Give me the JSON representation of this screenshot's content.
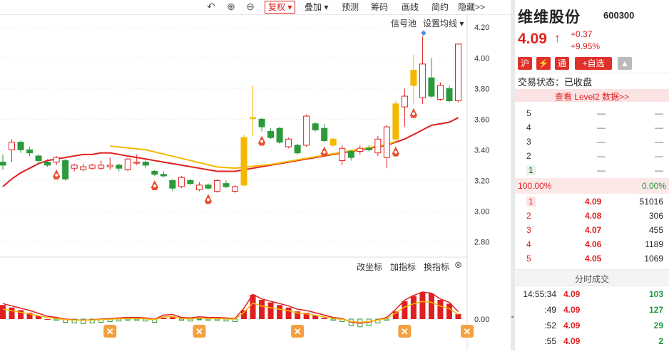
{
  "toolbar": {
    "undo_icon": "undo-icon",
    "zoom_in_icon": "zoom-in-icon",
    "zoom_out_icon": "zoom-out-icon",
    "fuquan": "复权",
    "diejia": "叠加",
    "yuce": "预测",
    "choumа": "筹码",
    "chouma": "筹码",
    "huaxian": "画线",
    "jianyue": "简约",
    "yincang": "隐藏>>"
  },
  "chart": {
    "signal_pool": "信号池",
    "set_ma": "设置均线",
    "price_ticks": [
      "4.20",
      "4.00",
      "3.80",
      "3.60",
      "3.40",
      "3.20",
      "3.00",
      "2.80"
    ],
    "indicator_ticks": [
      "0.00"
    ],
    "change_axis": "改坐标",
    "add_indicator": "加指标",
    "swap_indicator": "换指标",
    "colors": {
      "up": "#e02020",
      "down": "#2a9a3a",
      "highlight": "#f5b800",
      "ma": "#e02020",
      "ma2": "#f5b800"
    }
  },
  "chart_data": {
    "type": "candlestick",
    "ylim": [
      2.7,
      4.28
    ],
    "candles": [
      {
        "o": 3.32,
        "c": 3.3,
        "h": 3.37,
        "l": 3.27
      },
      {
        "o": 3.4,
        "c": 3.45,
        "h": 3.47,
        "l": 3.32
      },
      {
        "o": 3.45,
        "c": 3.4,
        "h": 3.46,
        "l": 3.38
      },
      {
        "o": 3.4,
        "c": 3.38,
        "h": 3.42,
        "l": 3.36
      },
      {
        "o": 3.36,
        "c": 3.33,
        "h": 3.37,
        "l": 3.31
      },
      {
        "o": 3.32,
        "c": 3.3,
        "h": 3.34,
        "l": 3.29
      },
      {
        "o": 3.32,
        "c": 3.35,
        "h": 3.36,
        "l": 3.3
      },
      {
        "o": 3.33,
        "c": 3.21,
        "h": 3.34,
        "l": 3.2
      },
      {
        "o": 3.28,
        "c": 3.3,
        "h": 3.31,
        "l": 3.26
      },
      {
        "o": 3.27,
        "c": 3.29,
        "h": 3.31,
        "l": 3.26
      },
      {
        "o": 3.28,
        "c": 3.3,
        "h": 3.31,
        "l": 3.27
      },
      {
        "o": 3.28,
        "c": 3.3,
        "h": 3.33,
        "l": 3.27
      },
      {
        "o": 3.29,
        "c": 3.3,
        "h": 3.35,
        "l": 3.27
      },
      {
        "o": 3.3,
        "c": 3.28,
        "h": 3.31,
        "l": 3.26
      },
      {
        "o": 3.27,
        "c": 3.34,
        "h": 3.35,
        "l": 3.26
      },
      {
        "o": 3.32,
        "c": 3.32,
        "h": 3.37,
        "l": 3.3
      },
      {
        "o": 3.32,
        "c": 3.3,
        "h": 3.33,
        "l": 3.28
      },
      {
        "o": 3.26,
        "c": 3.24,
        "h": 3.27,
        "l": 3.23
      },
      {
        "o": 3.24,
        "c": 3.23,
        "h": 3.26,
        "l": 3.22
      },
      {
        "o": 3.2,
        "c": 3.15,
        "h": 3.21,
        "l": 3.13
      },
      {
        "o": 3.16,
        "c": 3.22,
        "h": 3.23,
        "l": 3.15
      },
      {
        "o": 3.2,
        "c": 3.18,
        "h": 3.21,
        "l": 3.17
      },
      {
        "o": 3.14,
        "c": 3.17,
        "h": 3.19,
        "l": 3.13
      },
      {
        "o": 3.17,
        "c": 3.15,
        "h": 3.18,
        "l": 3.14
      },
      {
        "o": 3.13,
        "c": 3.2,
        "h": 3.21,
        "l": 3.12
      },
      {
        "o": 3.18,
        "c": 3.16,
        "h": 3.2,
        "l": 3.15
      },
      {
        "o": 3.13,
        "c": 3.16,
        "h": 3.17,
        "l": 3.12
      },
      {
        "o": 3.17,
        "c": 3.48,
        "h": 3.5,
        "l": 3.16,
        "hl": true
      },
      {
        "o": 3.61,
        "c": 3.61,
        "h": 3.82,
        "l": 3.49,
        "hl": true
      },
      {
        "o": 3.6,
        "c": 3.55,
        "h": 3.61,
        "l": 3.52
      },
      {
        "o": 3.52,
        "c": 3.48,
        "h": 3.54,
        "l": 3.47
      },
      {
        "o": 3.54,
        "c": 3.45,
        "h": 3.55,
        "l": 3.44
      },
      {
        "o": 3.42,
        "c": 3.47,
        "h": 3.48,
        "l": 3.41
      },
      {
        "o": 3.43,
        "c": 3.38,
        "h": 3.44,
        "l": 3.37
      },
      {
        "o": 3.43,
        "c": 3.62,
        "h": 3.63,
        "l": 3.42
      },
      {
        "o": 3.57,
        "c": 3.53,
        "h": 3.58,
        "l": 3.52
      },
      {
        "o": 3.54,
        "c": 3.46,
        "h": 3.57,
        "l": 3.45
      },
      {
        "o": 3.47,
        "c": 3.43,
        "h": 3.48,
        "l": 3.42,
        "hl": true
      },
      {
        "o": 3.33,
        "c": 3.41,
        "h": 3.43,
        "l": 3.3
      },
      {
        "o": 3.39,
        "c": 3.35,
        "h": 3.4,
        "l": 3.33
      },
      {
        "o": 3.39,
        "c": 3.41,
        "h": 3.43,
        "l": 3.37
      },
      {
        "o": 3.41,
        "c": 3.4,
        "h": 3.43,
        "l": 3.39
      },
      {
        "o": 3.38,
        "c": 3.47,
        "h": 3.49,
        "l": 3.36
      },
      {
        "o": 3.35,
        "c": 3.55,
        "h": 3.56,
        "l": 3.28
      },
      {
        "o": 3.47,
        "c": 3.7,
        "h": 3.72,
        "l": 3.45,
        "hl": true
      },
      {
        "o": 3.68,
        "c": 3.75,
        "h": 3.8,
        "l": 3.55
      },
      {
        "o": 3.82,
        "c": 3.92,
        "h": 4.02,
        "l": 3.7,
        "hl": true
      },
      {
        "o": 3.74,
        "c": 3.96,
        "h": 4.14,
        "l": 3.7
      },
      {
        "o": 3.87,
        "c": 3.75,
        "h": 4.0,
        "l": 3.74
      },
      {
        "o": 3.73,
        "c": 3.82,
        "h": 3.84,
        "l": 3.72
      },
      {
        "o": 3.8,
        "c": 3.72,
        "h": 3.82,
        "l": 3.71
      },
      {
        "o": 3.72,
        "c": 4.09,
        "h": 4.09,
        "l": 3.71
      }
    ],
    "ma_levels": [
      3.16,
      3.21,
      3.25,
      3.28,
      3.31,
      3.33,
      3.34,
      3.35,
      3.36,
      3.37,
      3.37,
      3.38,
      3.38,
      3.37,
      3.36,
      3.35,
      3.34,
      3.33,
      3.32,
      3.31,
      3.3,
      3.29,
      3.28,
      3.27,
      3.26,
      3.26,
      3.26,
      3.27,
      3.28,
      3.29,
      3.3,
      3.31,
      3.32,
      3.33,
      3.34,
      3.35,
      3.36,
      3.37,
      3.38,
      3.39,
      3.4,
      3.41,
      3.42,
      3.43,
      3.45,
      3.47,
      3.5,
      3.53,
      3.56,
      3.57,
      3.58,
      3.61
    ],
    "indicator": {
      "bars": [
        0.22,
        0.18,
        0.14,
        0.1,
        0.05,
        0.0,
        -0.02,
        -0.05,
        -0.06,
        -0.07,
        -0.06,
        -0.05,
        -0.04,
        -0.03,
        -0.02,
        -0.02,
        -0.03,
        -0.05,
        0.02,
        0.03,
        -0.02,
        -0.03,
        -0.01,
        -0.02,
        -0.02,
        -0.03,
        -0.04,
        0.14,
        0.38,
        0.3,
        0.26,
        0.22,
        0.18,
        0.12,
        0.1,
        0.06,
        0.02,
        -0.02,
        -0.04,
        -0.1,
        -0.12,
        -0.1,
        -0.06,
        -0.02,
        0.12,
        0.28,
        0.36,
        0.42,
        0.4,
        0.3,
        0.24,
        0.08
      ]
    },
    "signals_up": [
      6,
      17,
      23,
      29,
      36,
      44,
      46
    ],
    "signals_x": [
      12,
      22,
      33,
      45,
      52
    ]
  },
  "quote": {
    "name": "维维股份",
    "code": "600300",
    "price": "4.09",
    "change": "+0.37",
    "change_pct": "+9.95%",
    "badge_hu": "沪",
    "badge_tong": "通",
    "add_watch": "+自选",
    "trade_status": "交易状态：已收盘",
    "level2": "查看 Level2 数据>>",
    "sell": [
      {
        "lvl": "5",
        "price": "—",
        "vol": "—"
      },
      {
        "lvl": "4",
        "price": "—",
        "vol": "—"
      },
      {
        "lvl": "3",
        "price": "—",
        "vol": "—"
      },
      {
        "lvl": "2",
        "price": "—",
        "vol": "—"
      },
      {
        "lvl": "1",
        "price": "—",
        "vol": "—"
      }
    ],
    "ratio_left": "100.00%",
    "ratio_right": "0.00%",
    "buy": [
      {
        "lvl": "1",
        "price": "4.09",
        "vol": "51016"
      },
      {
        "lvl": "2",
        "price": "4.08",
        "vol": "306"
      },
      {
        "lvl": "3",
        "price": "4.07",
        "vol": "455"
      },
      {
        "lvl": "4",
        "price": "4.06",
        "vol": "1189"
      },
      {
        "lvl": "5",
        "price": "4.05",
        "vol": "1069"
      }
    ],
    "ticks_title": "分时成交",
    "ticks": [
      {
        "time": "14:55:34",
        "price": "4.09",
        "vol": "103"
      },
      {
        "time": ":49",
        "price": "4.09",
        "vol": "127"
      },
      {
        "time": ":52",
        "price": "4.09",
        "vol": "29"
      },
      {
        "time": ":55",
        "price": "4.09",
        "vol": "2"
      }
    ]
  }
}
